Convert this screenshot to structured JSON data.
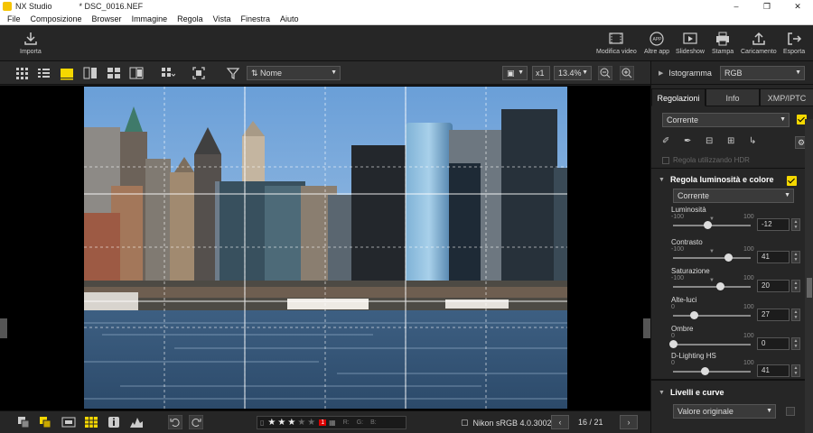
{
  "app": {
    "name": "NX Studio",
    "file_title": "* DSC_0016.NEF"
  },
  "menu": [
    "File",
    "Composizione",
    "Browser",
    "Immagine",
    "Regola",
    "Vista",
    "Finestra",
    "Aiuto"
  ],
  "toolbar": {
    "import_label": "Importa",
    "right_buttons": [
      {
        "label": "Modifica video",
        "icon": "film-edit-icon"
      },
      {
        "label": "Altre app",
        "icon": "app-icon"
      },
      {
        "label": "Slideshow",
        "icon": "slideshow-icon"
      },
      {
        "label": "Stampa",
        "icon": "printer-icon"
      },
      {
        "label": "Caricamento",
        "icon": "upload-icon"
      },
      {
        "label": "Esporta",
        "icon": "export-icon"
      }
    ]
  },
  "viewbar": {
    "sort_value": "Nome",
    "zoom_mode": "x1",
    "zoom_value": "13.4%"
  },
  "bottombar": {
    "stars_on": 3,
    "stars_total": 5,
    "label_value": "1",
    "r_label": "R:",
    "g_label": "G:",
    "b_label": "B:",
    "color_profile": "Nikon sRGB 4.0.3002",
    "page": "16 / 21"
  },
  "panel": {
    "histogram_label": "Istogramma",
    "histogram_mode": "RGB",
    "tabs": [
      "Regolazioni",
      "Info",
      "XMP/IPTC"
    ],
    "active_tab": 0,
    "preset_value": "Corrente",
    "hdr_label": "Regola utilizzando HDR",
    "section1_title": "Regola luminosità e colore",
    "section1_preset": "Corrente",
    "sliders": [
      {
        "name": "Luminosità",
        "min": "-100",
        "max": "100",
        "value": "-12",
        "position": -12,
        "range": [
          -100,
          100
        ],
        "marker": 0
      },
      {
        "name": "Contrasto",
        "min": "-100",
        "max": "100",
        "value": "41",
        "position": 41,
        "range": [
          -100,
          100
        ],
        "marker": 0
      },
      {
        "name": "Saturazione",
        "min": "-100",
        "max": "100",
        "value": "20",
        "position": 20,
        "range": [
          -100,
          100
        ],
        "marker": 0
      },
      {
        "name": "Alte-luci",
        "min": "0",
        "max": "100",
        "value": "27",
        "position": 27,
        "range": [
          0,
          100
        ],
        "marker": null
      },
      {
        "name": "Ombre",
        "min": "0",
        "max": "100",
        "value": "0",
        "position": 0,
        "range": [
          0,
          100
        ],
        "marker": null
      },
      {
        "name": "D-Lighting HS",
        "min": "0",
        "max": "100",
        "value": "41",
        "position": 41,
        "range": [
          0,
          100
        ],
        "marker": null
      }
    ],
    "section2_title": "Livelli e curve",
    "section2_value": "Valore originale"
  }
}
